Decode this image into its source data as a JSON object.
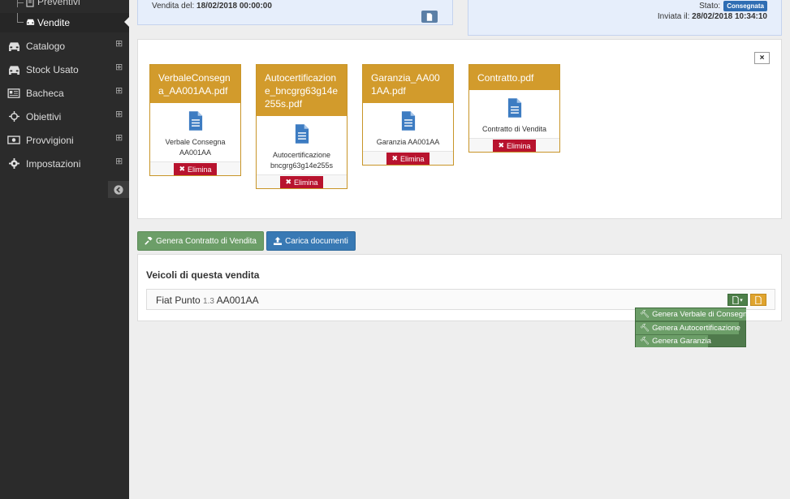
{
  "sidebar": {
    "sub_items": [
      {
        "label": "Preventivi",
        "icon": "document-icon",
        "active": false
      },
      {
        "label": "Vendite",
        "icon": "car-icon",
        "active": true
      }
    ],
    "nav_items": [
      {
        "label": "Catalogo",
        "icon": "car-icon"
      },
      {
        "label": "Stock Usato",
        "icon": "car-icon"
      },
      {
        "label": "Bacheca",
        "icon": "board-icon"
      },
      {
        "label": "Obiettivi",
        "icon": "target-icon"
      },
      {
        "label": "Provvigioni",
        "icon": "money-icon"
      },
      {
        "label": "Impostazioni",
        "icon": "gear-icon"
      }
    ],
    "expand_symbol": "⊞"
  },
  "sale_info": {
    "vendita_label": "Vendita del:",
    "vendita_date": "18/02/2018 00:00:00",
    "stato_label": "Stato:",
    "stato_value": "Consegnata",
    "inviata_label": "Inviata il:",
    "inviata_date": "28/02/2018 10:34:10"
  },
  "documents": [
    {
      "filename": "VerbaleConsegna_AA001AA.pdf",
      "description": "Verbale Consegna AA001AA",
      "delete_label": "Elimina"
    },
    {
      "filename": "Autocertificazione_bncgrg63g14e255s.pdf",
      "description": "Autocertificazione bncgrg63g14e255s",
      "delete_label": "Elimina"
    },
    {
      "filename": "Garanzia_AA001AA.pdf",
      "description": "Garanzia AA001AA",
      "delete_label": "Elimina"
    },
    {
      "filename": "Contratto.pdf",
      "description": "Contratto di Vendita",
      "delete_label": "Elimina"
    }
  ],
  "close_symbol": "×",
  "actions": {
    "genera_contratto": "Genera Contratto di Vendita",
    "carica_documenti": "Carica documenti"
  },
  "vehicles": {
    "title": "Veicoli di questa vendita",
    "items": [
      {
        "model": "Fiat Punto",
        "engine": "1.3",
        "plate": "AA001AA"
      }
    ]
  },
  "dropdown_menu": [
    {
      "label": "Genera Verbale di Consegna"
    },
    {
      "label": "Genera Autocertificazione"
    },
    {
      "label": "Genera Garanzia"
    }
  ],
  "colors": {
    "sidebar_bg": "#2b2b2b",
    "doc_header": "#d29b2c",
    "delete_red": "#b8132e",
    "green_btn": "#6c9e68",
    "blue_btn": "#3879b4",
    "status_blue": "#2f6db3"
  }
}
